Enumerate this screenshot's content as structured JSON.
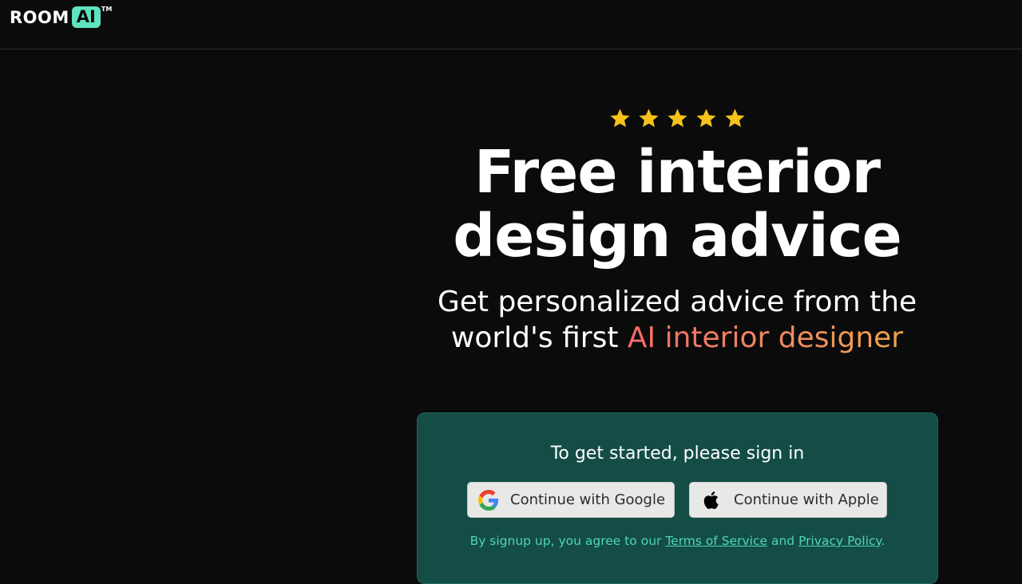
{
  "header": {
    "logo_room": "ROOM",
    "logo_ai": "AI",
    "logo_tm": "TM"
  },
  "hero": {
    "rating_stars": 5,
    "headline_line1": "Free interior",
    "headline_line2": "design advice",
    "subhead_line1": "Get personalized advice from the",
    "subhead_line2_prefix": "world's first ",
    "subhead_line2_accent": "AI interior designer"
  },
  "signin": {
    "title": "To get started, please sign in",
    "google_label": "Continue with Google",
    "apple_label": "Continue with Apple",
    "legal_prefix": "By signup up, you agree to our ",
    "terms_label": "Terms of Service",
    "legal_and": " and ",
    "privacy_label": "Privacy Policy",
    "legal_suffix": "."
  },
  "colors": {
    "background": "#0b0b0b",
    "logo_accent": "#5fe3c0",
    "star": "#f6c21a",
    "card": "#134d45",
    "legal_text": "#4fd6b4",
    "accent_gradient_start": "#f76a6a",
    "accent_gradient_end": "#efa24c"
  }
}
